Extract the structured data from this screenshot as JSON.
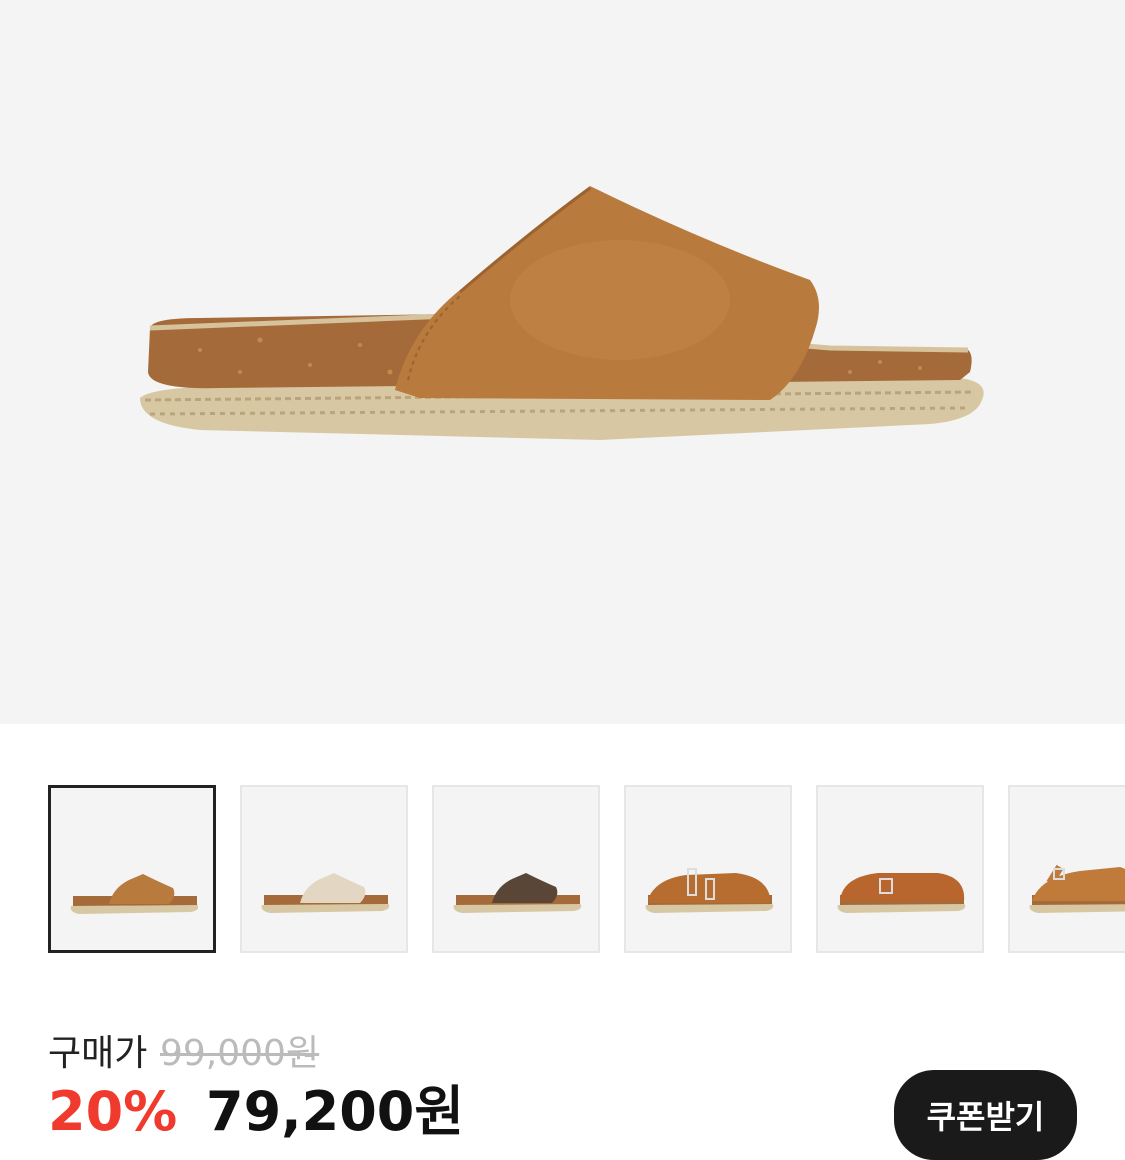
{
  "product": {
    "main_image": {
      "icon": "suede-slide-sandal-image",
      "color": "#b87a3d"
    },
    "thumbnails": [
      {
        "name": "thumbnail-tan-slide",
        "color": "#b87a3d",
        "style": "slide",
        "selected": true
      },
      {
        "name": "thumbnail-beige-slide",
        "color": "#e3d6c3",
        "style": "slide",
        "selected": false
      },
      {
        "name": "thumbnail-brown-slide",
        "color": "#5a4637",
        "style": "slide",
        "selected": false
      },
      {
        "name": "thumbnail-tan-double-buckle",
        "color": "#b86d30",
        "style": "buckle",
        "selected": false
      },
      {
        "name": "thumbnail-tan-clog",
        "color": "#b8662e",
        "style": "clog",
        "selected": false
      },
      {
        "name": "thumbnail-tan-strap-sandal",
        "color": "#c07a3a",
        "style": "strap",
        "selected": false
      }
    ]
  },
  "price": {
    "label": "구매가",
    "original": "99,000원",
    "discount_rate": "20%",
    "sale": "79,200원",
    "discount_color": "#f03a2e"
  },
  "coupon": {
    "label": "쿠폰받기"
  }
}
